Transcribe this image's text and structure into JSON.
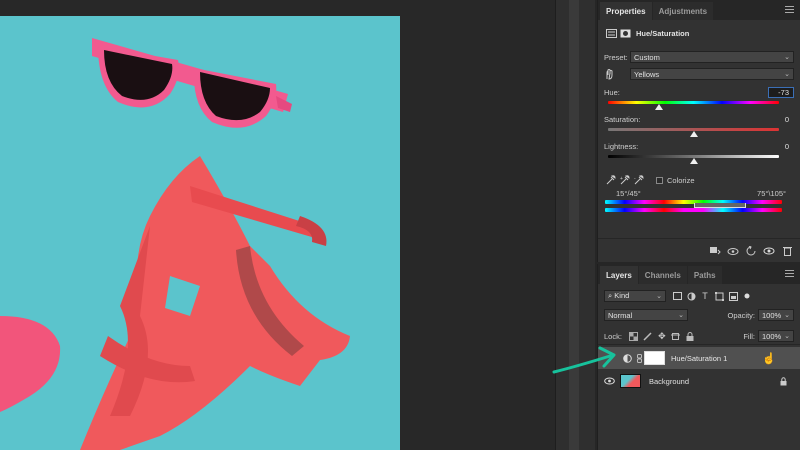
{
  "properties": {
    "tabs": [
      {
        "label": "Properties"
      },
      {
        "label": "Adjustments"
      }
    ],
    "adjustment_name": "Hue/Saturation",
    "preset_label": "Preset:",
    "preset_value": "Custom",
    "channel_value": "Yellows",
    "hue": {
      "label": "Hue:",
      "value": "-73",
      "level": 0.3
    },
    "saturation": {
      "label": "Saturation:",
      "value": "0",
      "level": 0.5
    },
    "lightness": {
      "label": "Lightness:",
      "value": "0",
      "level": 0.5
    },
    "colorize_label": "Colorize",
    "range_left": "15°/45°",
    "range_right": "75°\\105°"
  },
  "layers": {
    "tabs": [
      {
        "label": "Layers"
      },
      {
        "label": "Channels"
      },
      {
        "label": "Paths"
      }
    ],
    "filter_kind": "Kind",
    "blend_mode": "Normal",
    "opacity_label": "Opacity:",
    "opacity_value": "100%",
    "lock_label": "Lock:",
    "fill_label": "Fill:",
    "fill_value": "100%",
    "items": [
      {
        "name": "Hue/Saturation 1"
      },
      {
        "name": "Background"
      }
    ]
  },
  "colors": {
    "panel_bg": "#323232",
    "canvas_bg": "#5bc4cc",
    "sandal": "#f0595c",
    "sunglasses": "#f25a8f",
    "arrow": "#17c29c"
  }
}
